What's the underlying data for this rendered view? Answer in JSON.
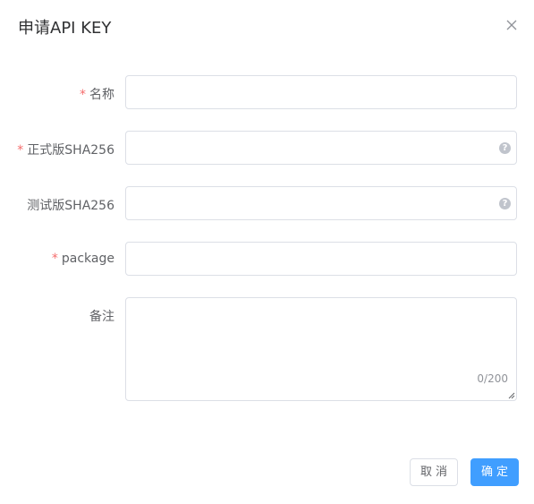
{
  "dialog": {
    "title": "申请API KEY"
  },
  "form": {
    "name": {
      "required_mark": "*",
      "label": "名称",
      "value": ""
    },
    "release_sha256": {
      "required_mark": "*",
      "label": "正式版SHA256",
      "value": "",
      "help": "?"
    },
    "test_sha256": {
      "label": "测试版SHA256",
      "value": "",
      "help": "?"
    },
    "package": {
      "required_mark": "*",
      "label": "package",
      "value": ""
    },
    "remark": {
      "label": "备注",
      "value": "",
      "word_count": "0/200"
    }
  },
  "footer": {
    "cancel_label": "取消",
    "confirm_label": "确定"
  },
  "colors": {
    "primary": "#409eff",
    "required": "#f56c6c",
    "border": "#dcdfe6",
    "label": "#606266"
  },
  "icons": {
    "close": "close-icon",
    "help": "question-circle-icon"
  }
}
